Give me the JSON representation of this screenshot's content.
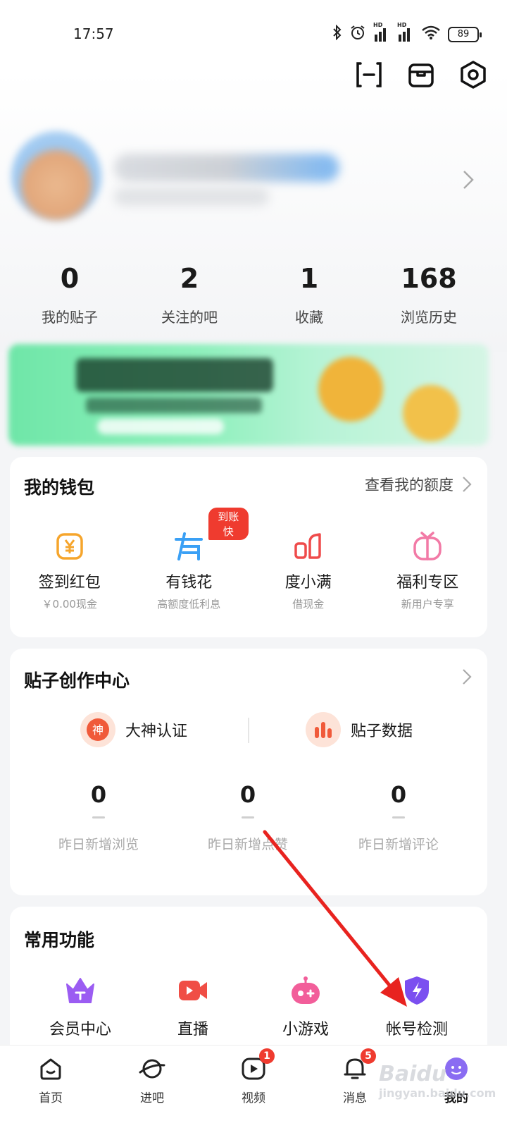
{
  "status_bar": {
    "time": "17:57",
    "battery": "89",
    "hd_label": "HD"
  },
  "stats": [
    {
      "value": "0",
      "label": "我的贴子"
    },
    {
      "value": "2",
      "label": "关注的吧"
    },
    {
      "value": "1",
      "label": "收藏"
    },
    {
      "value": "168",
      "label": "浏览历史"
    }
  ],
  "wallet": {
    "title": "我的钱包",
    "link": "查看我的额度",
    "items": [
      {
        "label": "签到红包",
        "sub": "￥0.00现金",
        "icon": "yuan-icon"
      },
      {
        "label": "有钱花",
        "sub": "高额度低利息",
        "icon": "youqianhua-icon",
        "badge": "到账快"
      },
      {
        "label": "度小满",
        "sub": "借现金",
        "icon": "duxiaoman-icon"
      },
      {
        "label": "福利专区",
        "sub": "新用户专享",
        "icon": "gift-icon"
      }
    ],
    "colors": {
      "yuan": "#f6a52c",
      "youqianhua": "#3aa0f5",
      "duxiaoman": "#ef4b4b",
      "gift": "#f27aa6"
    }
  },
  "creator": {
    "title": "贴子创作中心",
    "actions": [
      {
        "label": "大神认证",
        "icon_text": "神"
      },
      {
        "label": "贴子数据"
      }
    ],
    "stats": [
      {
        "value": "0",
        "label": "昨日新增浏览"
      },
      {
        "value": "0",
        "label": "昨日新增点赞"
      },
      {
        "value": "0",
        "label": "昨日新增评论"
      }
    ]
  },
  "common": {
    "title": "常用功能",
    "items": [
      {
        "label": "会员中心",
        "icon": "crown-icon"
      },
      {
        "label": "直播",
        "icon": "live-camera-icon"
      },
      {
        "label": "小游戏",
        "icon": "game-icon"
      },
      {
        "label": "帐号检测",
        "icon": "shield-lightning-icon"
      }
    ]
  },
  "nav": [
    {
      "label": "首页",
      "icon": "home-icon"
    },
    {
      "label": "进吧",
      "icon": "planet-icon"
    },
    {
      "label": "视频",
      "icon": "video-icon",
      "badge": "1"
    },
    {
      "label": "消息",
      "icon": "bell-icon",
      "badge": "5"
    },
    {
      "label": "我的",
      "icon": "avatar-icon",
      "active": true
    }
  ],
  "watermark": {
    "brand": "Baidu",
    "sub": "jingyan.baidu.com"
  },
  "colors": {
    "accent_red": "#ef3b2f",
    "annotation_arrow": "#e8231f"
  }
}
